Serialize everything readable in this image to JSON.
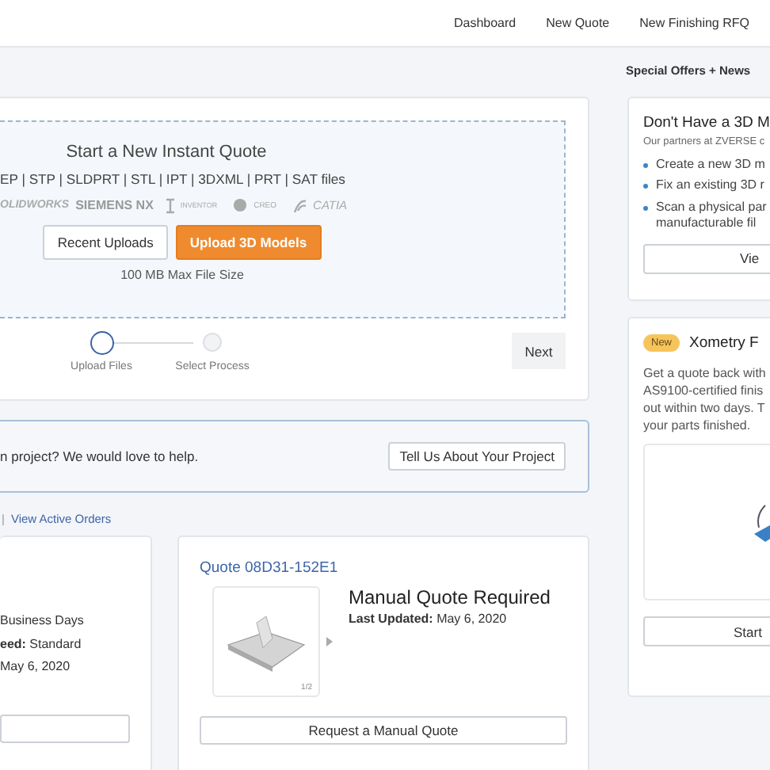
{
  "nav": [
    "Dashboard",
    "New Quote",
    "New Finishing RFQ"
  ],
  "upload": {
    "title": "Start a New Instant Quote",
    "formats": "EP | STP | SLDPRT | STL | IPT | 3DXML | PRT | SAT files",
    "cad_logos": [
      {
        "kind": "solidworks",
        "label": "OLIDWORKS"
      },
      {
        "kind": "nx",
        "label": "SIEMENS NX"
      },
      {
        "kind": "inventor",
        "label": "INVENTOR"
      },
      {
        "kind": "creo",
        "label": "CREO"
      },
      {
        "kind": "catia",
        "label": "CATIA"
      }
    ],
    "buttons": [
      {
        "label": "Recent Uploads",
        "kind": "secondary"
      },
      {
        "label": "Upload 3D Models",
        "kind": "primary"
      }
    ],
    "max_size": "100 MB Max File Size"
  },
  "steps": [
    {
      "label": "Upload Files",
      "selected": true
    },
    {
      "label": "Select Process",
      "selected": false
    }
  ],
  "next_button": "Next",
  "help_banner": {
    "text": "n project? We would love to help.",
    "button": "Tell Us About Your Project"
  },
  "links": {
    "separator": "|",
    "link": "View Active Orders"
  },
  "order_card": {
    "lines": [
      "Business Days",
      "**eed:** Standard",
      "May 6, 2020"
    ]
  },
  "quote_card": {
    "title": "Quote 08D31-152E1",
    "status": "Manual Quote Required",
    "updated": "**Last Updated:** May 6, 2020",
    "pager": "1/2",
    "button": "Request a Manual Quote"
  },
  "sidebar": {
    "heading": "Special Offers + News",
    "offer": {
      "title": "Don't Have a 3D M",
      "subtitle": "Our partners at ZVERSE c",
      "bullets": [
        "Create a new 3D m",
        "Fix an existing 3D r",
        "Scan a physical par\nmanufacturable fil"
      ],
      "button": "Vie"
    },
    "finishing": {
      "badge": "New",
      "title": "Xometry F",
      "lines": [
        "Get a quote back with",
        "AS9100-certified finis",
        "out within two days. T",
        "your parts finished."
      ],
      "button": "Start"
    }
  }
}
